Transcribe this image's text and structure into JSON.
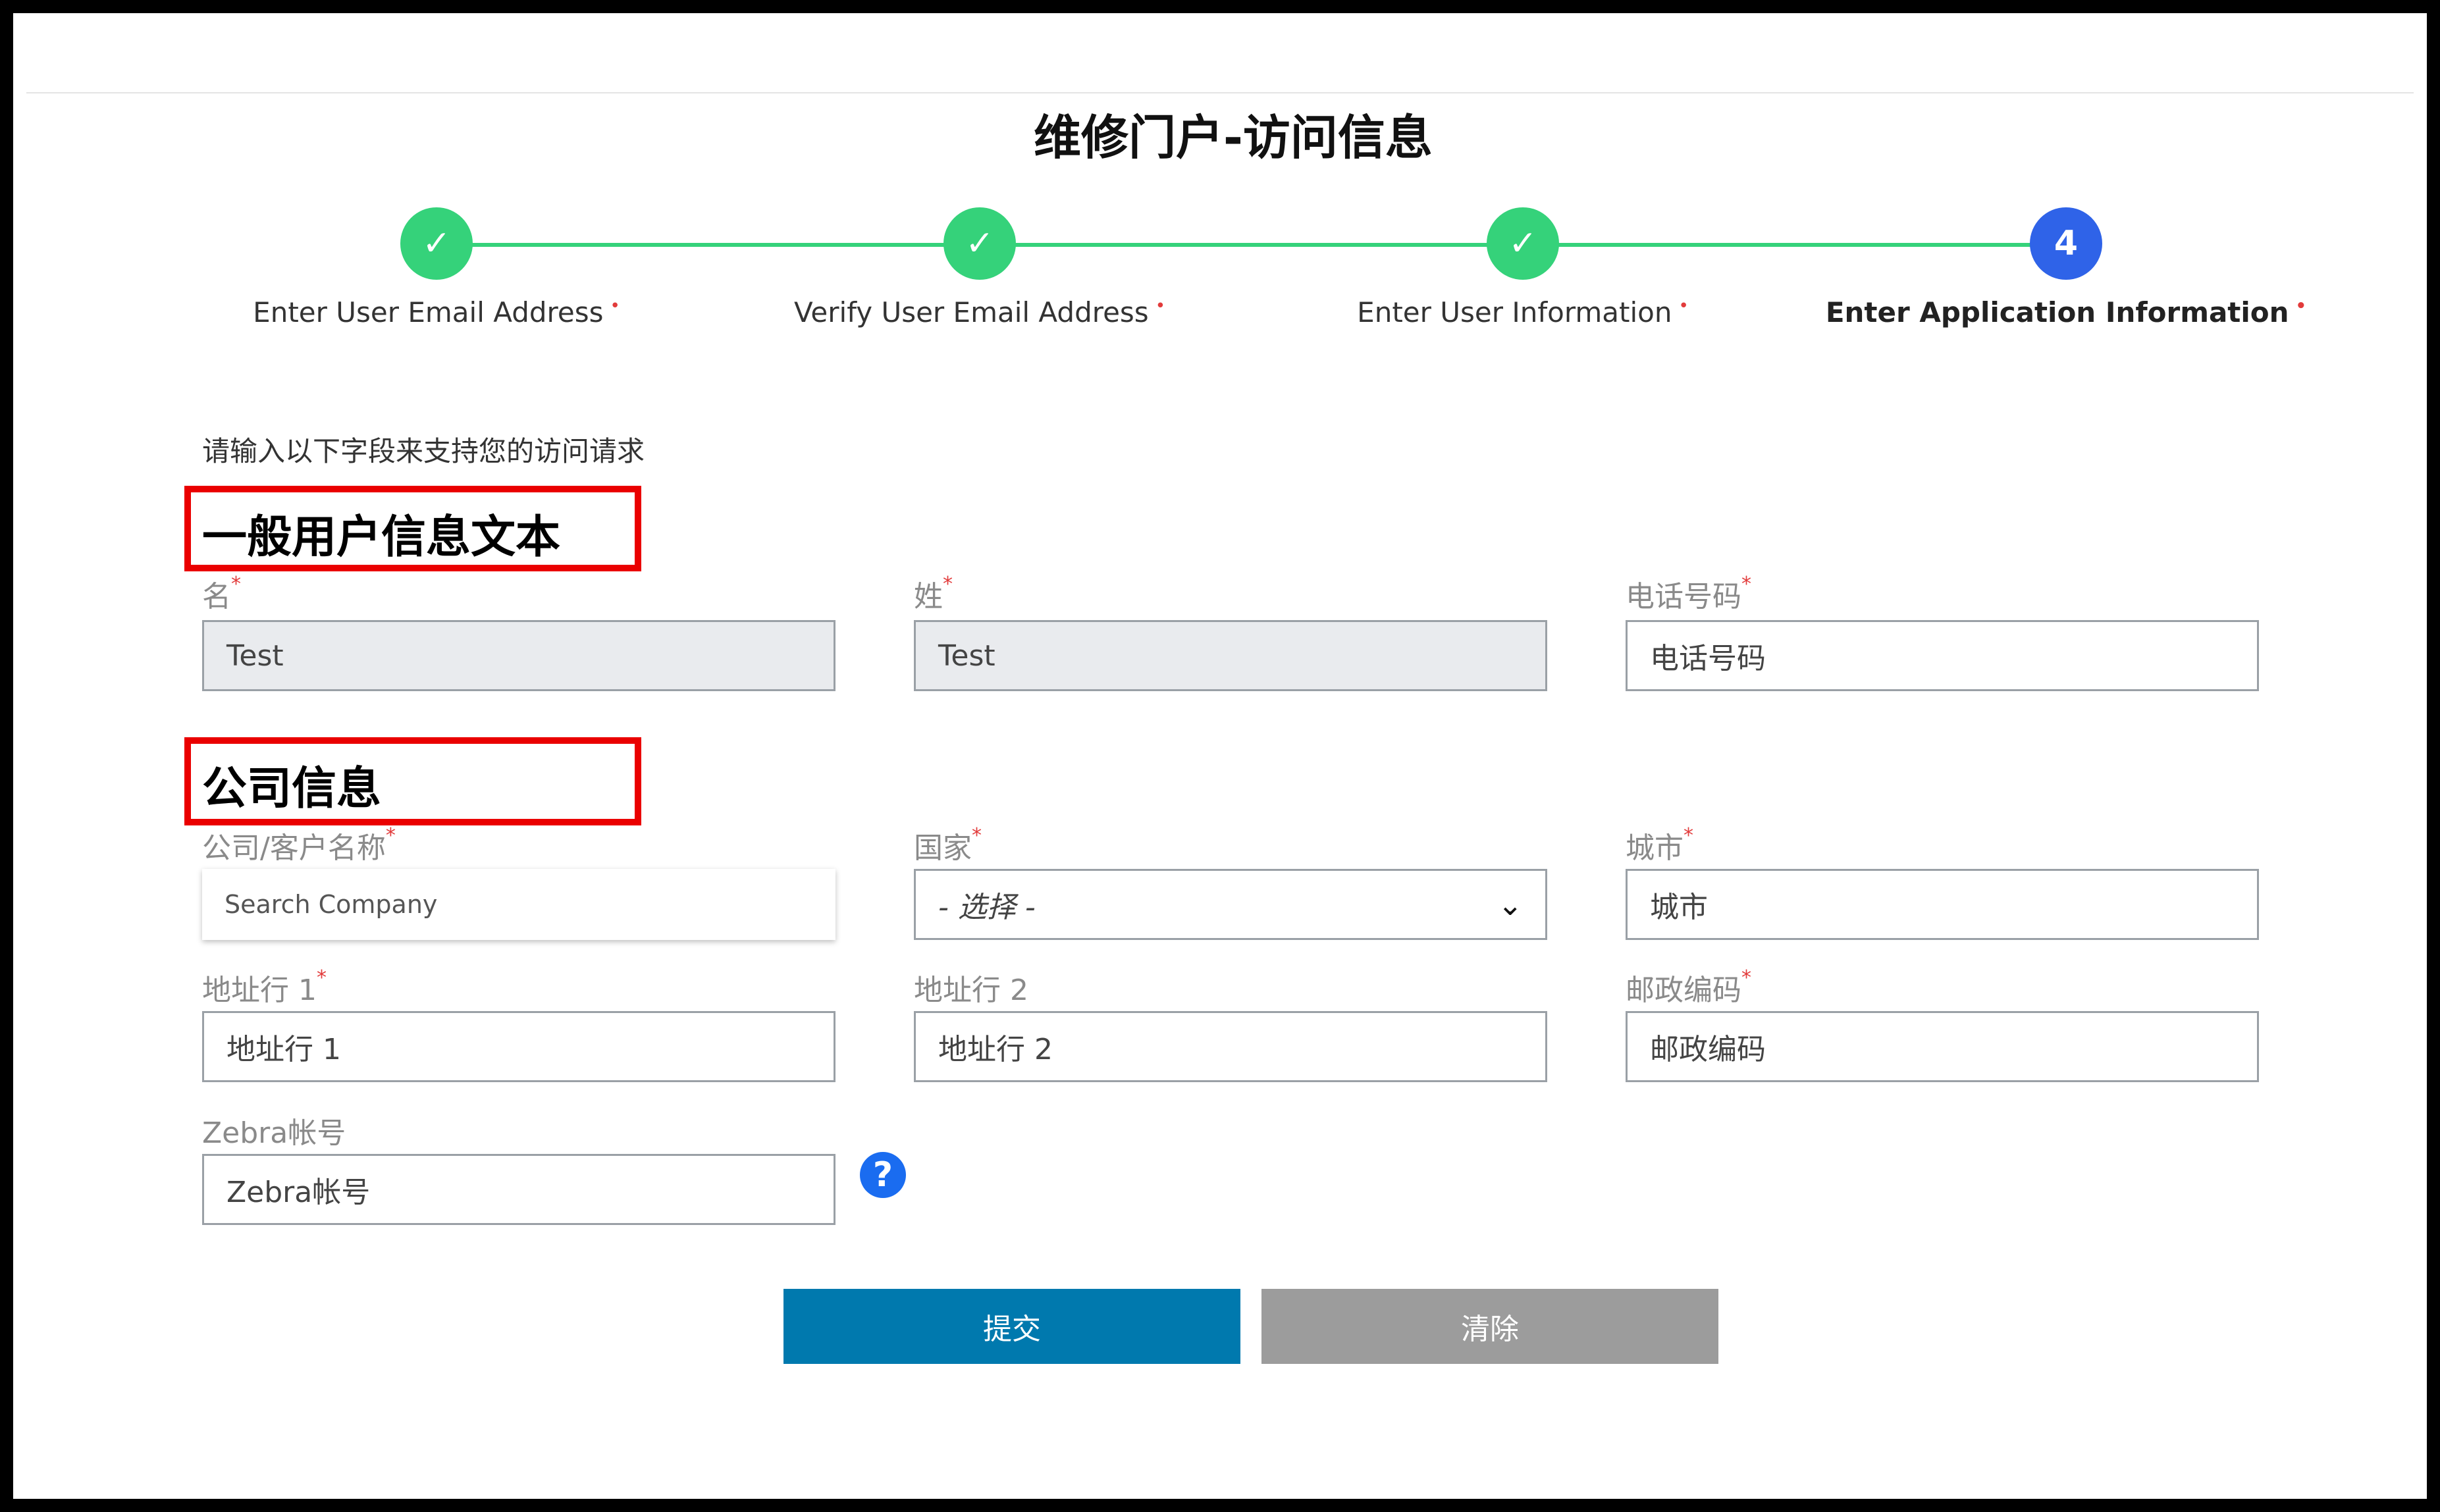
{
  "page": {
    "title": "维修门户-访问信息"
  },
  "steps": [
    {
      "label": "Enter User Email Address",
      "status": "done",
      "marker": "✓"
    },
    {
      "label": "Verify User Email Address",
      "status": "done",
      "marker": "✓"
    },
    {
      "label": "Enter User Information",
      "status": "done",
      "marker": "✓"
    },
    {
      "label": "Enter Application Information",
      "status": "active",
      "marker": "4"
    }
  ],
  "required_marker": "•",
  "intro": "请输入以下字段来支持您的访问请求",
  "sections": {
    "general": "一般用户信息文本",
    "company": "公司信息"
  },
  "fields": {
    "first_name": {
      "label": "名",
      "required": "*",
      "value": "Test"
    },
    "last_name": {
      "label": "姓",
      "required": "*",
      "value": "Test"
    },
    "phone": {
      "label": "电话号码",
      "required": "*",
      "placeholder": "电话号码"
    },
    "company": {
      "label": "公司/客户名称",
      "required": "*",
      "placeholder": "Search Company"
    },
    "country": {
      "label": "国家",
      "required": "*",
      "selected": "- 选择 -"
    },
    "city": {
      "label": "城市",
      "required": "*",
      "placeholder": "城市"
    },
    "address1": {
      "label": "地址行 1",
      "required": "*",
      "placeholder": "地址行 1"
    },
    "address2": {
      "label": "地址行 2",
      "placeholder": "地址行 2"
    },
    "postal": {
      "label": "邮政编码",
      "required": "*",
      "placeholder": "邮政编码"
    },
    "zebra_account": {
      "label": "Zebra帐号",
      "placeholder": "Zebra帐号"
    }
  },
  "icons": {
    "help": "question-circle-icon",
    "dropdown": "chevron-down-icon",
    "check": "checkmark-icon"
  },
  "buttons": {
    "submit": "提交",
    "clear": "清除"
  },
  "colors": {
    "step_done": "#35d27a",
    "step_active": "#2f63e8",
    "submit": "#0079ae",
    "clear": "#9c9c9c",
    "highlight": "#ea0000"
  }
}
